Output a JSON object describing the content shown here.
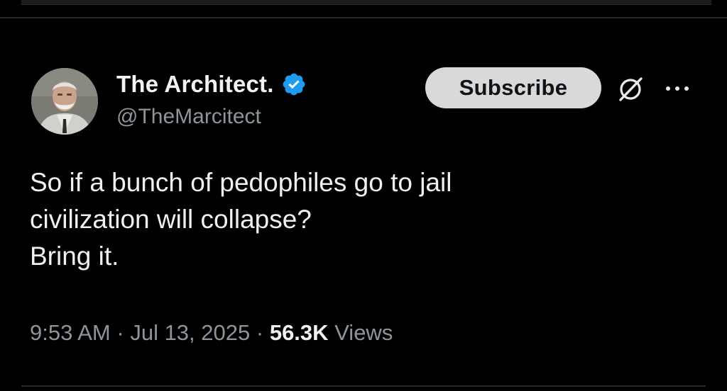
{
  "tweet": {
    "author": {
      "display_name": "The Architect.",
      "handle": "@TheMarcitect",
      "verified": true,
      "avatar_icon": "avatar-portrait"
    },
    "header_actions": {
      "subscribe_label": "Subscribe",
      "grok_icon": "grok-icon",
      "more_icon": "more-icon"
    },
    "text_lines": [
      "So if a bunch of pedophiles go to jail",
      "civilization will collapse?",
      "Bring it."
    ],
    "meta": {
      "time": "9:53 AM",
      "separator": "·",
      "date": "Jul 13, 2025",
      "views_count": "56.3K",
      "views_label": "Views"
    }
  },
  "colors": {
    "background": "#000000",
    "text_primary": "#eef0f1",
    "text_secondary": "#8d949a",
    "verified_badge": "#1d9bf0",
    "subscribe_bg": "#d9d9d9"
  }
}
